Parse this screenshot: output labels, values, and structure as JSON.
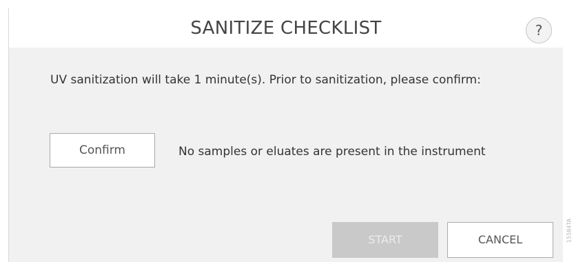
{
  "dialog": {
    "title": "SANITIZE CHECKLIST",
    "help_label": "?",
    "message": "UV sanitization will take 1 minute(s). Prior to sanitization, please confirm:",
    "checklist": [
      {
        "button_label": "Confirm",
        "text": "No samples or eluates are present in the instrument"
      }
    ],
    "buttons": {
      "start_label": "START",
      "cancel_label": "CANCEL"
    }
  },
  "figure_id": "15584TA"
}
